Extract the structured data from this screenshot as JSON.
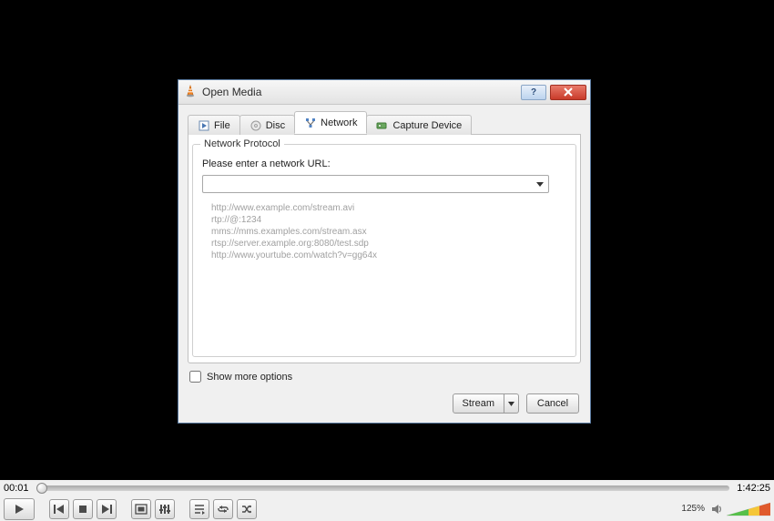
{
  "dialog": {
    "title": "Open Media",
    "tabs": {
      "file": "File",
      "disc": "Disc",
      "network": "Network",
      "capture": "Capture Device"
    },
    "network": {
      "protocol_legend": "Network Protocol",
      "url_prompt": "Please enter a network URL:",
      "url_value": "",
      "examples": {
        "l1": "http://www.example.com/stream.avi",
        "l2": "rtp://@:1234",
        "l3": "mms://mms.examples.com/stream.asx",
        "l4": "rtsp://server.example.org:8080/test.sdp",
        "l5": "http://www.yourtube.com/watch?v=gg64x"
      }
    },
    "more_options_label": "Show more options",
    "stream_label": "Stream",
    "cancel_label": "Cancel"
  },
  "player": {
    "elapsed": "00:01",
    "total": "1:42:25",
    "zoom": "125%"
  }
}
